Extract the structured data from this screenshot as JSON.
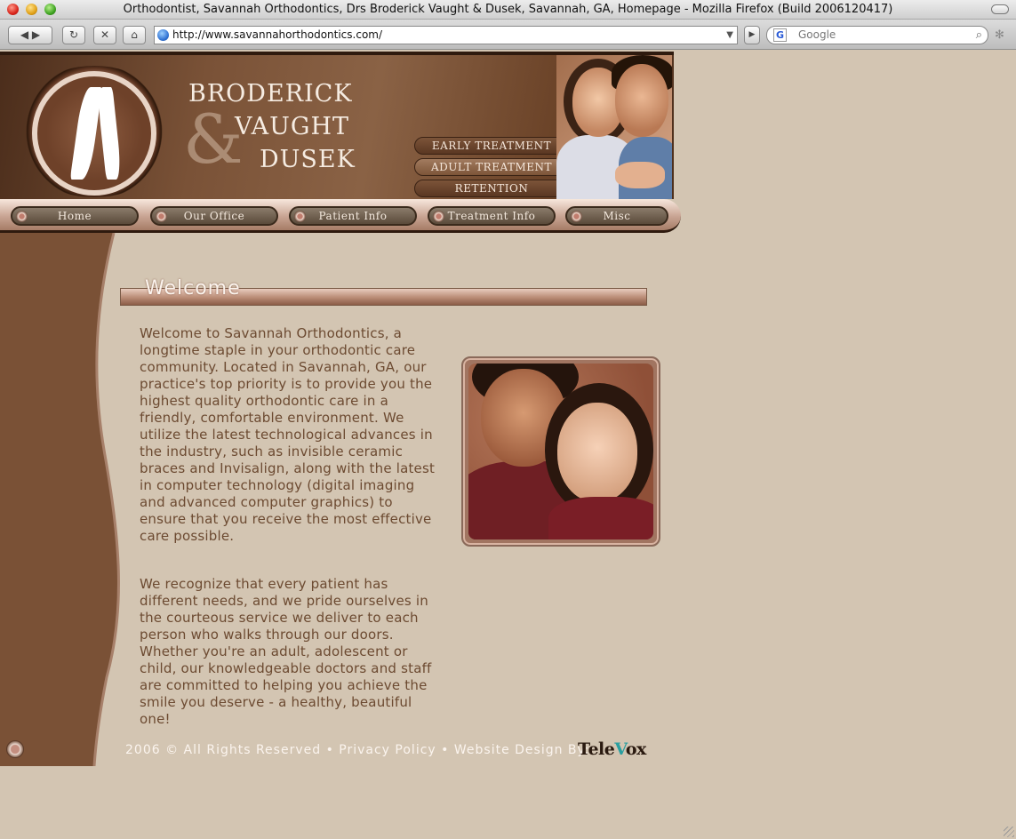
{
  "browser": {
    "window_title": "Orthodontist, Savannah Orthodontics, Drs Broderick Vaught & Dusek, Savannah, GA, Homepage - Mozilla Firefox (Build 2006120417)",
    "url": "http://www.savannahorthodontics.com/",
    "search_placeholder": "Google",
    "search_engine_glyph": "G",
    "back_glyph": "◀ ▶",
    "reload_glyph": "↻",
    "stop_glyph": "✕",
    "home_glyph": "⌂",
    "go_glyph": "▶",
    "dropdown_glyph": "▼",
    "magnifier_glyph": "⌕",
    "spinner_glyph": "✻"
  },
  "header": {
    "brand_line_1": "BRODERICK",
    "brand_line_2": "VAUGHT",
    "brand_line_3": "DUSEK",
    "brand_ampersand": "&",
    "quick_links": [
      "EARLY TREATMENT",
      "ADULT TREATMENT",
      "RETENTION"
    ]
  },
  "nav": {
    "items": [
      "Home",
      "Our Office",
      "Patient Info",
      "Treatment Info",
      "Misc"
    ]
  },
  "main": {
    "section_title": "Welcome",
    "paragraphs": [
      "Welcome to Savannah Orthodontics, a longtime staple in your orthodontic care community. Located in Savannah, GA, our practice's top priority is to provide you the highest quality orthodontic care in a friendly, comfortable environment. We utilize the latest technological advances in the industry, such as invisible ceramic braces and Invisalign, along with the latest in computer technology (digital imaging and advanced computer graphics) to ensure that you receive the most effective care possible.",
      "We recognize that every patient has different needs, and we pride ourselves in the courteous service we deliver to each person who walks through our doors. Whether you're an adult, adolescent or child, our knowledgeable doctors and staff are committed to helping you achieve the smile you deserve - a healthy, beautiful one!"
    ]
  },
  "footer": {
    "copyright": "2006 © All Rights Reserved",
    "separator": "•",
    "privacy_link": "Privacy Policy",
    "design_by": "Website Design By:",
    "televox_part_1": "Tele",
    "televox_part_2": "V",
    "televox_part_3": "ox"
  },
  "colors": {
    "page_bg": "#d3c5b2",
    "left_band": "#7a5136",
    "body_text": "#6c4a31",
    "accent_teal": "#2a9fa0"
  }
}
